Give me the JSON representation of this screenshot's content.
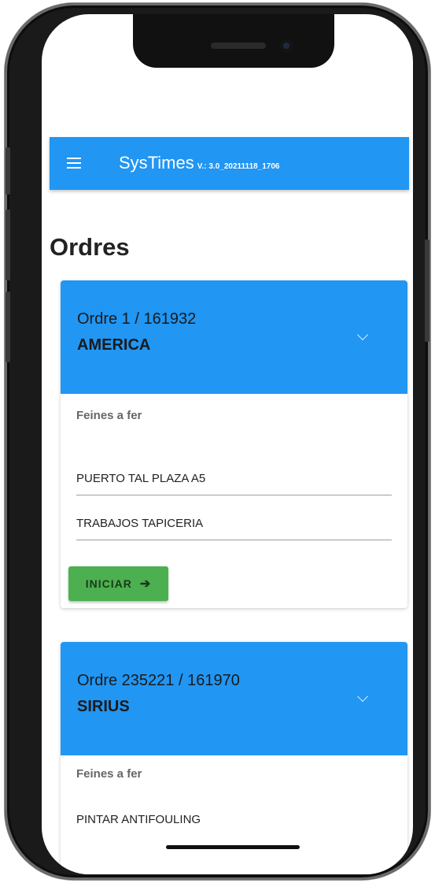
{
  "app": {
    "title": "SysTimes",
    "version": "V.: 3.0_20211118_1706"
  },
  "page": {
    "title": "Ordres"
  },
  "orders": [
    {
      "title_line1": "Ordre 1 / 161932",
      "title_line2": "AMERICA",
      "tasks_label": "Feines a fer",
      "tasks": [
        "PUERTO TAL PLAZA A5",
        "TRABAJOS TAPICERIA"
      ],
      "start_label": "INICIAR"
    },
    {
      "title_line1": "Ordre 235221 / 161970",
      "title_line2": "SIRIUS",
      "tasks_label": "Feines a fer",
      "tasks": [
        "PINTAR ANTIFOULING"
      ]
    }
  ],
  "icons": {
    "menu": "menu-icon",
    "chevron": "chevron-down-icon",
    "arrow": "arrow-right-icon"
  },
  "colors": {
    "primary": "#2196F3",
    "start_button": "#4CAF50"
  }
}
